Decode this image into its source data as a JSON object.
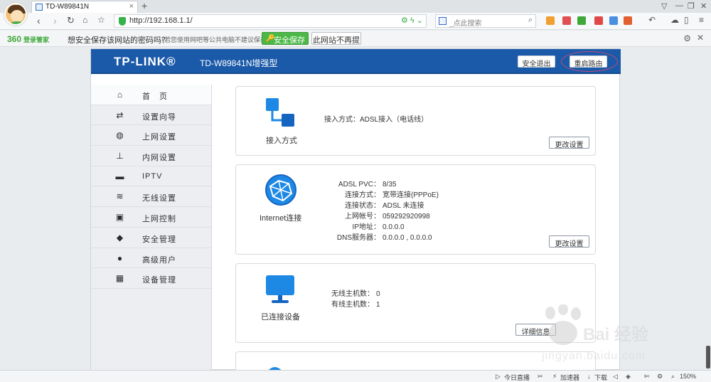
{
  "browser": {
    "tab_title": "TD-W89841N",
    "url": "http://192.168.1.1/",
    "search_placeholder": "_点此搜索"
  },
  "password_bar": {
    "brand": "360",
    "brand_sub": "登录管家",
    "question": "想安全保存该网站的密码吗？",
    "note": "（若您使用网吧等公共电脑不建议保存）",
    "save_label": "安全保存",
    "never_label": "此网站不再提示"
  },
  "router": {
    "logo": "TP-LINK®",
    "model": "TD-W89841N增强型",
    "logout_label": "安全退出",
    "reboot_label": "重启路由",
    "sidebar": [
      {
        "label": "首　页",
        "icon": "home-icon"
      },
      {
        "label": "设置向导",
        "icon": "arrows-icon"
      },
      {
        "label": "上网设置",
        "icon": "globe-icon"
      },
      {
        "label": "内网设置",
        "icon": "lan-icon"
      },
      {
        "label": "IPTV",
        "icon": "tv-icon"
      },
      {
        "label": "无线设置",
        "icon": "wifi-icon"
      },
      {
        "label": "上网控制",
        "icon": "lock-icon"
      },
      {
        "label": "安全管理",
        "icon": "shield-icon"
      },
      {
        "label": "高级用户",
        "icon": "user-icon"
      },
      {
        "label": "设备管理",
        "icon": "grid-icon"
      }
    ],
    "cards": {
      "access": {
        "caption": "接入方式",
        "rows": [
          {
            "k": "接入方式：",
            "v": "ADSL接入（电话线）"
          }
        ],
        "button": "更改设置"
      },
      "internet": {
        "caption": "Internet连接",
        "rows": [
          {
            "k": "ADSL PVC：",
            "v": "8/35"
          },
          {
            "k": "连接方式：",
            "v": "宽带连接(PPPoE)"
          },
          {
            "k": "连接状态：",
            "v": "ADSL 未连接"
          },
          {
            "k": "上网帐号：",
            "v": "059292920998"
          },
          {
            "k": "IP地址：",
            "v": "0.0.0.0"
          },
          {
            "k": "DNS服务器：",
            "v": "0.0.0.0 , 0.0.0.0"
          }
        ],
        "button": "更改设置"
      },
      "devices": {
        "caption": "已连接设备",
        "rows": [
          {
            "k": "无线主机数：",
            "v": "0"
          },
          {
            "k": "有线主机数：",
            "v": "1"
          }
        ],
        "button": "详细信息"
      }
    }
  },
  "statusbar": {
    "live": "今日直播",
    "accelerator": "加速器",
    "download": "下载",
    "zoom": "150%"
  },
  "watermark": {
    "text": "Bai 经验",
    "url": "jingyan.baidu.com"
  },
  "colors": {
    "header_blue": "#1b5aa9",
    "icon_blue": "#1e88e5",
    "save_green": "#4cb848"
  }
}
